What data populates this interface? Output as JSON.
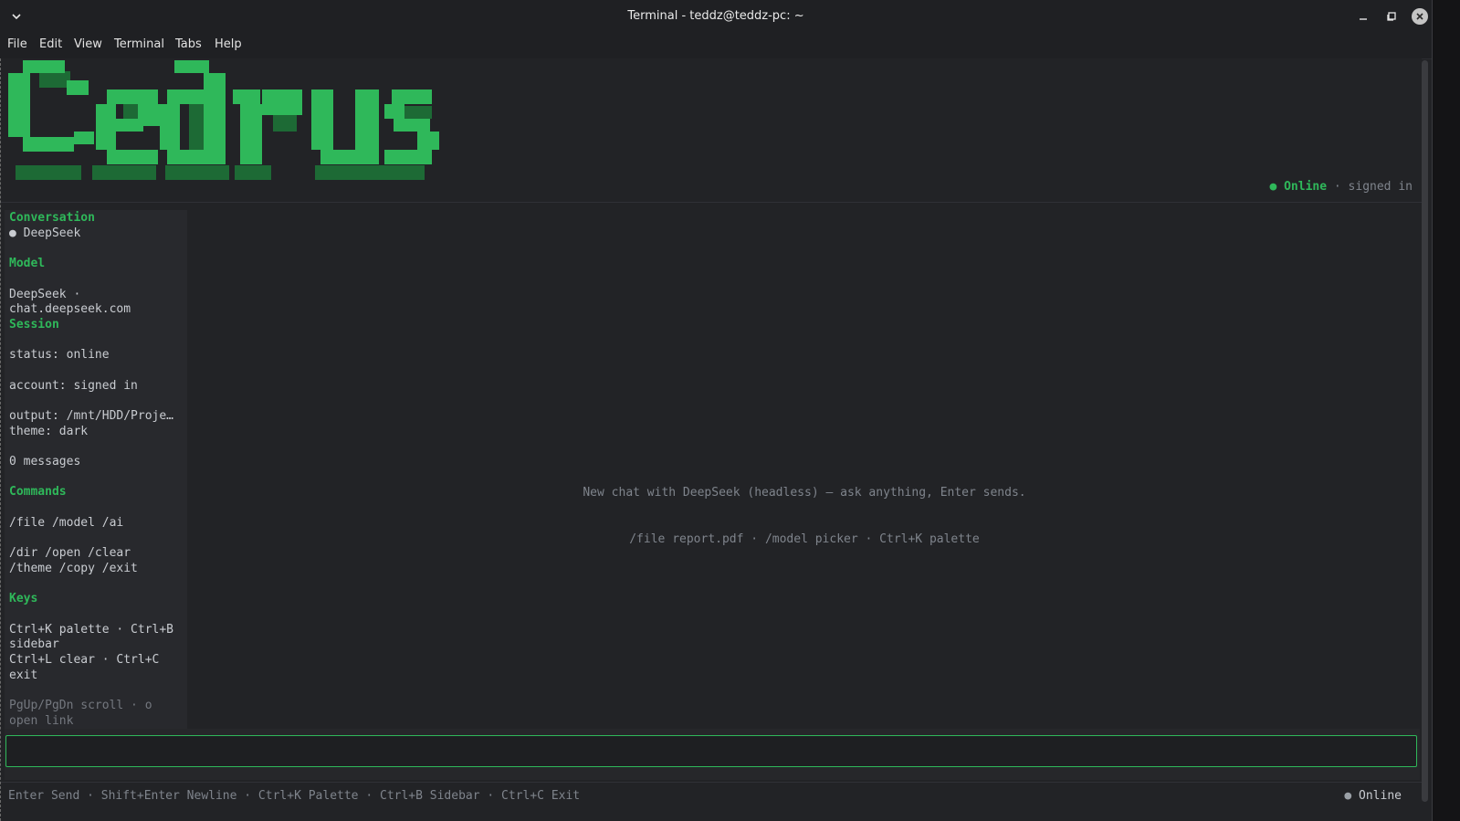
{
  "window": {
    "title": "Terminal - teddz@teddz-pc: ~"
  },
  "menu": [
    "File",
    "Edit",
    "View",
    "Terminal",
    "Tabs",
    "Help"
  ],
  "app": {
    "logo_text": "Cedrus",
    "header_status": {
      "dot": "●",
      "state": "Online",
      "separator": " · ",
      "account": "signed in"
    }
  },
  "sidebar": {
    "conversation_heading": "Conversation",
    "conversation_item": "● DeepSeek",
    "model_heading": "Model",
    "model_line1": "DeepSeek ·",
    "model_line2": "chat.deepseek.com",
    "session_heading": "Session",
    "session_status": "status: online",
    "session_account": "account: signed in",
    "session_output": "output: /mnt/HDD/Proje…",
    "session_theme": "theme: dark",
    "session_messages": "0 messages",
    "commands_heading": "Commands",
    "commands_line1": "/file /model /ai",
    "commands_line2": "/dir /open /clear",
    "commands_line3": "/theme /copy /exit",
    "keys_heading": "Keys",
    "keys_line1": "Ctrl+K palette · Ctrl+B",
    "keys_line2": "sidebar",
    "keys_line3": "Ctrl+L clear · Ctrl+C",
    "keys_line4": "exit",
    "keys_line5": "PgUp/PgDn scroll · o",
    "keys_line6": "open link"
  },
  "main": {
    "empty_line1": "New chat with DeepSeek (headless) — ask anything, Enter sends.",
    "empty_line2": "/file report.pdf · /model picker · Ctrl+K palette"
  },
  "input": {
    "value": ""
  },
  "footer": {
    "hints": "Enter Send · Shift+Enter Newline · Ctrl+K Palette · Ctrl+B Sidebar · Ctrl+C Exit",
    "status_dot": "●",
    "status": "Online"
  },
  "colors": {
    "accent": "#2fb85a",
    "background": "#222326",
    "text": "#c9ccd1",
    "dim": "#7f848c"
  },
  "icons": {
    "window_menu": "chevron-down-icon",
    "minimize": "minimize-icon",
    "maximize": "maximize-icon",
    "close": "close-icon"
  }
}
